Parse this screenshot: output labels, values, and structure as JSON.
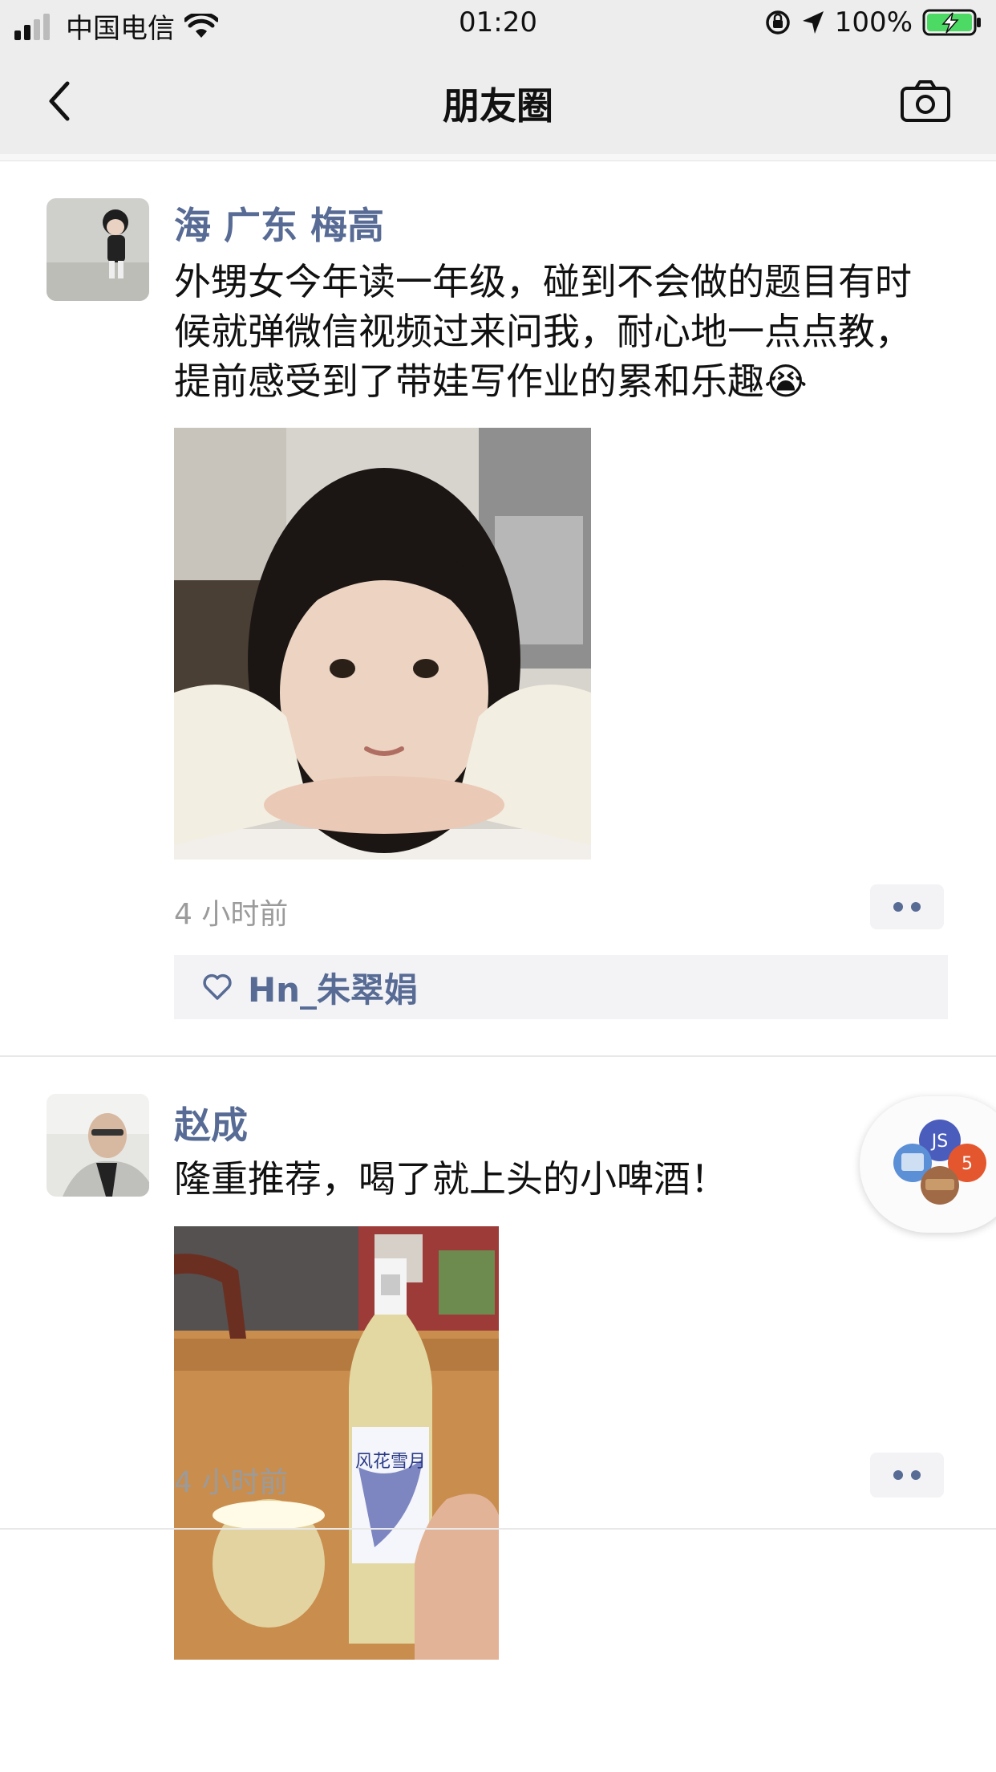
{
  "status_bar": {
    "carrier": "中国电信",
    "time": "01:20",
    "battery": "100%"
  },
  "nav": {
    "title": "朋友圈"
  },
  "posts": [
    {
      "author": "海 广东  梅高",
      "text": "外甥女今年读一年级，碰到不会做的题目有时候就弹微信视频过来问我，耐心地一点点教，提前感受到了带娃写作业的累和乐趣😭",
      "time": "4 小时前",
      "likes": [
        "Hn_朱翠娟"
      ]
    },
    {
      "author": "赵成",
      "text": "隆重推荐，喝了就上头的小啤酒！",
      "time": "4 小时前",
      "photo_bottle_labels": [
        "花雪",
        "风花雪月"
      ]
    }
  ],
  "floating_bubble": {
    "icons": [
      "JS",
      "5"
    ]
  },
  "colors": {
    "link_blue": "#576b95",
    "nav_bg": "#ededed",
    "time_gray": "#9b9b9b"
  }
}
